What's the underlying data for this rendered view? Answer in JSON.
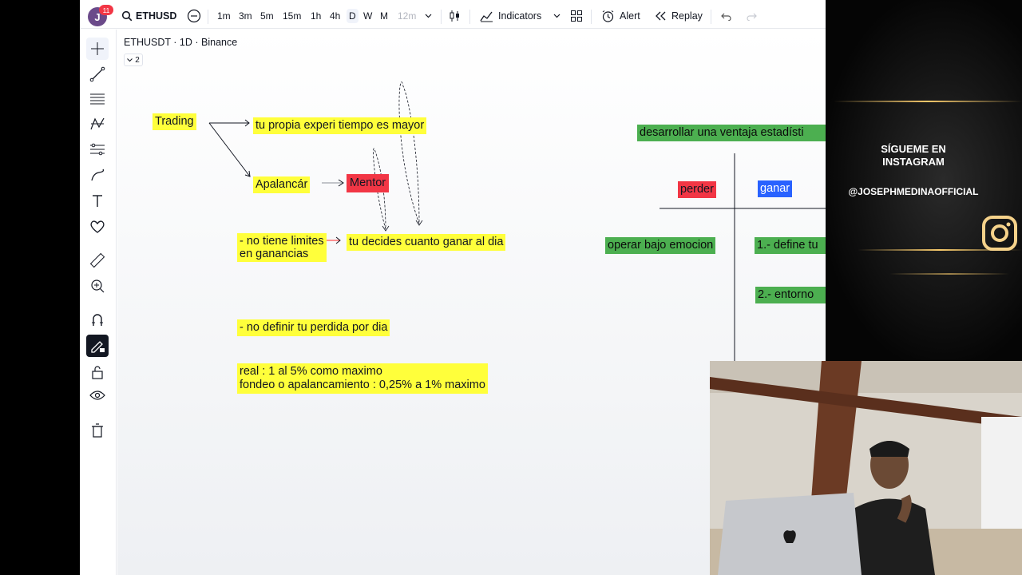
{
  "topbar": {
    "avatar_letter": "J",
    "notifications": "11",
    "symbol": "ETHUSD",
    "intervals": [
      "1m",
      "3m",
      "5m",
      "15m",
      "1h",
      "4h",
      "D",
      "W",
      "M",
      "12m"
    ],
    "indicators_label": "Indicators",
    "alert_label": "Alert",
    "replay_label": "Replay"
  },
  "legend": {
    "title": "ETHUSDT · 1D · Binance",
    "count": "2"
  },
  "notes": {
    "trading": "Trading",
    "experiencia": "tu propia experi tiempo es mayor",
    "apalancar": "Apalancár",
    "mentor": "Mentor",
    "limites_line1": "- no tiene limites",
    "limites_line2": "en ganancias",
    "decides": "tu decides cuanto ganar al dia",
    "perdida": "- no definir tu perdida por dia",
    "real": "real : 1 al 5% como maximo",
    "fondeo": "fondeo o apalancamiento : 0,25% a 1% maximo",
    "ventaja": "desarrollar una ventaja estadísti",
    "perder": "perder",
    "ganar": "ganar",
    "emocion": "operar bajo emocion",
    "define": "1.- define tu",
    "entorno": "2.- entorno"
  },
  "overlay": {
    "follow_line1": "SÍGUEME EN",
    "follow_line2": "INSTAGRAM",
    "handle": "@JOSEPHMEDINAOFFICIAL"
  },
  "colors": {
    "yellow": "#ffff3b",
    "green": "#4caf50",
    "red": "#f23645",
    "blue": "#2962ff"
  }
}
